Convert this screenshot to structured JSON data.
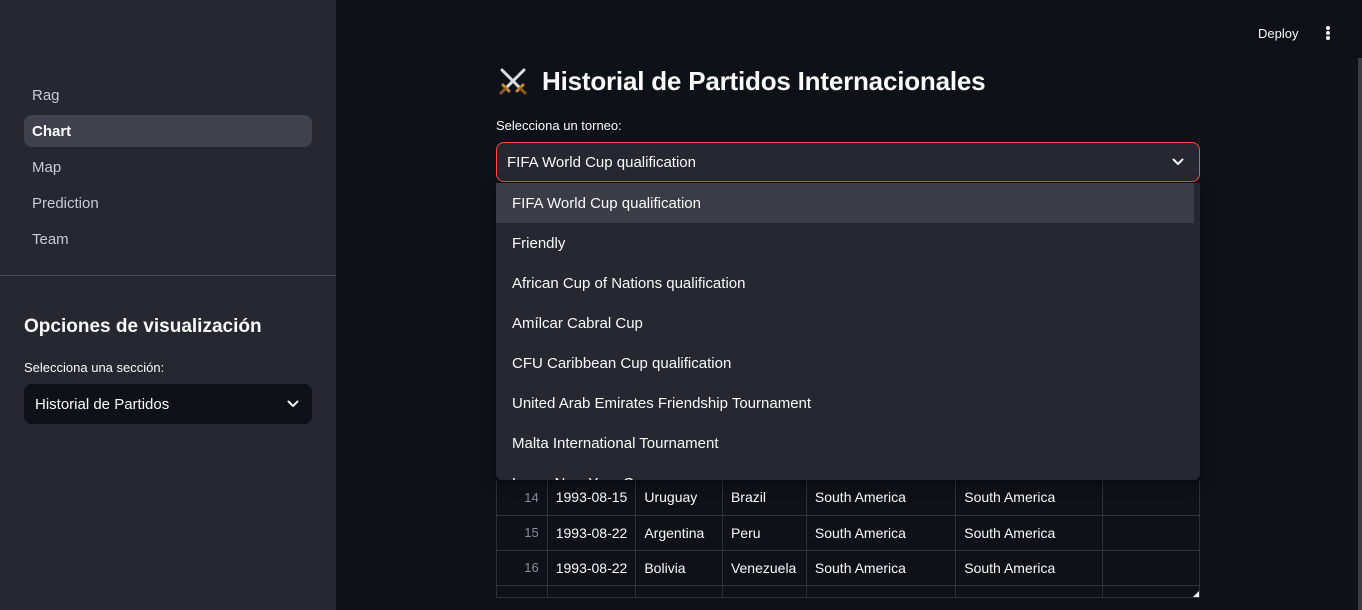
{
  "sidebar": {
    "nav": [
      "Rag",
      "Chart",
      "Map",
      "Prediction",
      "Team"
    ],
    "active": "Chart",
    "heading": "Opciones de visualización",
    "section_label": "Selecciona una sección:",
    "section_value": "Historial de Partidos"
  },
  "header": {
    "deploy_label": "Deploy",
    "menu_icon": "kebab-menu-icon"
  },
  "main": {
    "title_icon": "crossed-swords-icon",
    "title": "Historial de Partidos Internacionales",
    "tournament_label": "Selecciona un torneo:",
    "tournament_value": "FIFA World Cup qualification",
    "dropdown_options": [
      "FIFA World Cup qualification",
      "Friendly",
      "African Cup of Nations qualification",
      "Amílcar Cabral Cup",
      "CFU Caribbean Cup qualification",
      "United Arab Emirates Friendship Tournament",
      "Malta International Tournament",
      "Lunar New Year Cup"
    ],
    "highlighted_option": "FIFA World Cup qualification",
    "table": {
      "rows": [
        {
          "index": "14",
          "date": "1993-08-15",
          "home": "Uruguay",
          "away": "Brazil",
          "home_conf": "South America",
          "away_conf": "South America"
        },
        {
          "index": "15",
          "date": "1993-08-22",
          "home": "Argentina",
          "away": "Peru",
          "home_conf": "South America",
          "away_conf": "South America"
        },
        {
          "index": "16",
          "date": "1993-08-22",
          "home": "Bolivia",
          "away": "Venezuela",
          "home_conf": "South America",
          "away_conf": "South America"
        }
      ]
    }
  },
  "colors": {
    "accent": "#ff4b4b",
    "background": "#0e1117",
    "sidebar": "#262730"
  }
}
